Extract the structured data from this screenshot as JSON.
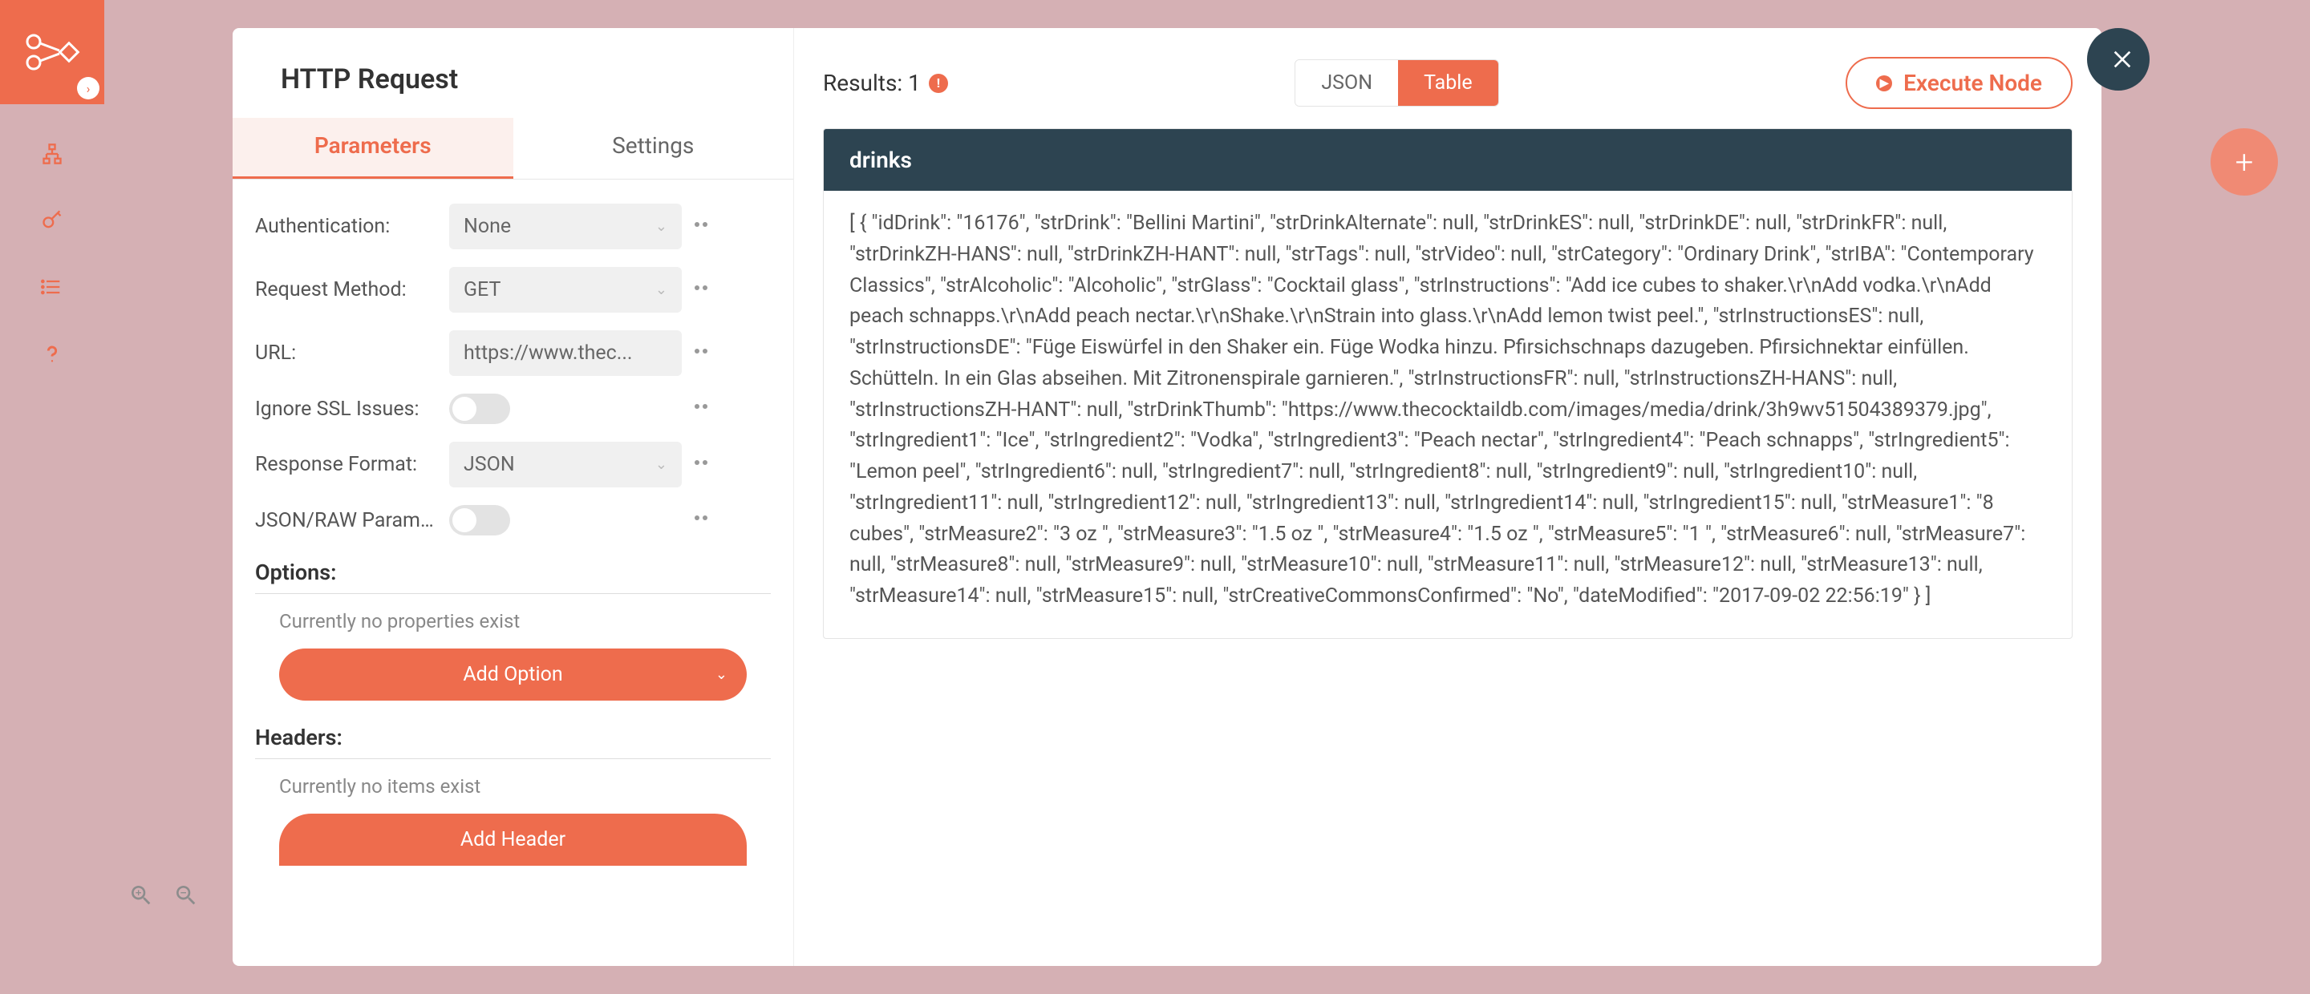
{
  "sidebar": {
    "logo_glyph": "○—◇"
  },
  "modal": {
    "title": "HTTP Request",
    "tabs": {
      "parameters": "Parameters",
      "settings": "Settings"
    },
    "params": {
      "authentication": {
        "label": "Authentication:",
        "value": "None"
      },
      "request_method": {
        "label": "Request Method:",
        "value": "GET"
      },
      "url": {
        "label": "URL:",
        "value": "https://www.thec..."
      },
      "ignore_ssl": {
        "label": "Ignore SSL Issues:"
      },
      "response_format": {
        "label": "Response Format:",
        "value": "JSON"
      },
      "json_raw": {
        "label": "JSON/RAW Parame..."
      }
    },
    "options_section": {
      "label": "Options:",
      "empty": "Currently no properties exist",
      "button": "Add Option"
    },
    "headers_section": {
      "label": "Headers:",
      "empty": "Currently no items exist",
      "button": "Add Header"
    }
  },
  "results": {
    "label": "Results: 1",
    "view_json": "JSON",
    "view_table": "Table",
    "execute": "Execute Node",
    "table_header": "drinks",
    "table_content": "[ { \"idDrink\": \"16176\", \"strDrink\": \"Bellini Martini\", \"strDrinkAlternate\": null, \"strDrinkES\": null, \"strDrinkDE\": null, \"strDrinkFR\": null, \"strDrinkZH-HANS\": null, \"strDrinkZH-HANT\": null, \"strTags\": null, \"strVideo\": null, \"strCategory\": \"Ordinary Drink\", \"strIBA\": \"Contemporary Classics\", \"strAlcoholic\": \"Alcoholic\", \"strGlass\": \"Cocktail glass\", \"strInstructions\": \"Add ice cubes to shaker.\\r\\nAdd vodka.\\r\\nAdd peach schnapps.\\r\\nAdd peach nectar.\\r\\nShake.\\r\\nStrain into glass.\\r\\nAdd lemon twist peel.\", \"strInstructionsES\": null, \"strInstructionsDE\": \"Füge Eiswürfel in den Shaker ein. Füge Wodka hinzu. Pfirsichschnaps dazugeben. Pfirsichnektar einfüllen. Schütteln. In ein Glas abseihen. Mit Zitronenspirale garnieren.\", \"strInstructionsFR\": null, \"strInstructionsZH-HANS\": null, \"strInstructionsZH-HANT\": null, \"strDrinkThumb\": \"https://www.thecocktaildb.com/images/media/drink/3h9wv51504389379.jpg\", \"strIngredient1\": \"Ice\", \"strIngredient2\": \"Vodka\", \"strIngredient3\": \"Peach nectar\", \"strIngredient4\": \"Peach schnapps\", \"strIngredient5\": \"Lemon peel\", \"strIngredient6\": null, \"strIngredient7\": null, \"strIngredient8\": null, \"strIngredient9\": null, \"strIngredient10\": null, \"strIngredient11\": null, \"strIngredient12\": null, \"strIngredient13\": null, \"strIngredient14\": null, \"strIngredient15\": null, \"strMeasure1\": \"8 cubes\", \"strMeasure2\": \"3 oz \", \"strMeasure3\": \"1.5 oz \", \"strMeasure4\": \"1.5 oz \", \"strMeasure5\": \"1 \", \"strMeasure6\": null, \"strMeasure7\": null, \"strMeasure8\": null, \"strMeasure9\": null, \"strMeasure10\": null, \"strMeasure11\": null, \"strMeasure12\": null, \"strMeasure13\": null, \"strMeasure14\": null, \"strMeasure15\": null, \"strCreativeCommonsConfirmed\": \"No\", \"dateModified\": \"2017-09-02 22:56:19\" } ]"
  }
}
